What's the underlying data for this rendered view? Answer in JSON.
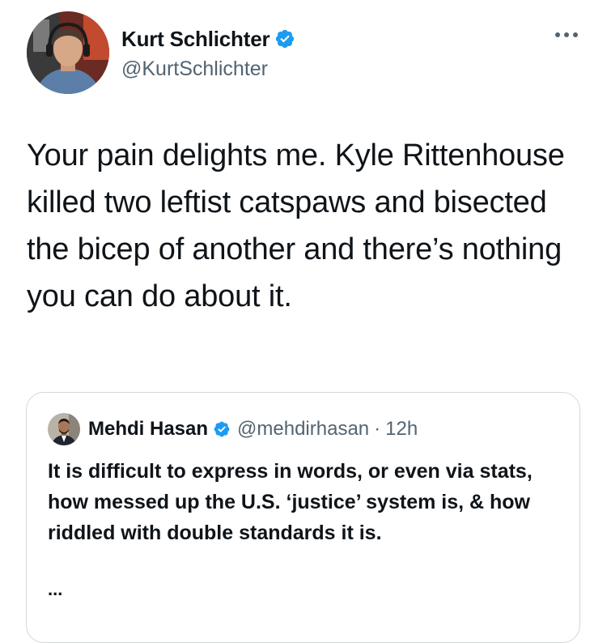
{
  "author": {
    "display_name": "Kurt Schlichter",
    "handle": "@KurtSchlichter",
    "verified": true
  },
  "tweet": {
    "text": "Your pain delights me. Kyle Rittenhouse killed two leftist catspaws and bisected the bicep of another and there’s nothing you can do about it."
  },
  "quoted_tweet": {
    "display_name": "Mehdi Hasan",
    "handle": "@mehdirhasan",
    "separator": "·",
    "time": "12h",
    "verified": true,
    "text": "It is difficult to express in words, or even via stats, how messed up the U.S. ‘justice’ system is, & how riddled with double standards it is.",
    "truncation": "..."
  },
  "icons": {
    "verified": "verified-badge-icon",
    "more": "more-horizontal-icon"
  },
  "colors": {
    "verified_blue": "#1d9bf0",
    "secondary_text": "#536471",
    "primary_text": "#0f1419",
    "border": "#cfd9de"
  }
}
